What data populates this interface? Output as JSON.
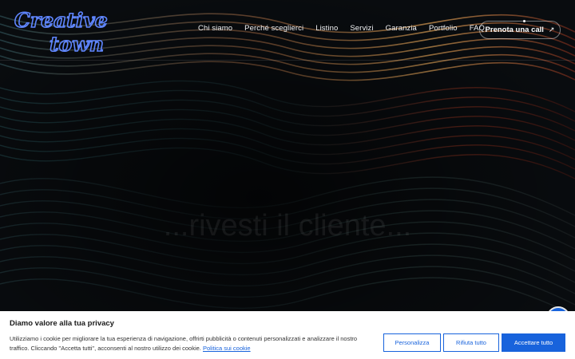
{
  "brand": {
    "logo_line1": "Creative",
    "logo_line2": "town"
  },
  "nav": {
    "items": [
      {
        "label": "Chi siamo"
      },
      {
        "label": "Perché sceglierci"
      },
      {
        "label": "Listino"
      },
      {
        "label": "Servizi"
      },
      {
        "label": "Garanzia"
      },
      {
        "label": "Portfolio"
      },
      {
        "label": "FAQ"
      }
    ],
    "cta_label": "Prenota una call",
    "cta_icon": "arrow-up-right-icon"
  },
  "hero": {
    "faded_heading": "...rivesti il cliente..."
  },
  "cookie_banner": {
    "title": "Diamo valore alla tua privacy",
    "text": "Utilizziamo i cookie per migliorare la tua esperienza di navigazione, offrirti pubblicità o contenuti personalizzati e analizzare il nostro traffico. Cliccando \"Accetta tutti\", acconsenti al nostro utilizzo dei cookie.",
    "policy_link": "Politica sui cookie",
    "buttons": {
      "customize": "Personalizza",
      "reject": "Rifiuta tutto",
      "accept": "Accettare tutto"
    },
    "accent_color": "#1863dc"
  },
  "accessibility_button": {
    "icon": "accessibility-icon",
    "color": "#1863dc"
  }
}
